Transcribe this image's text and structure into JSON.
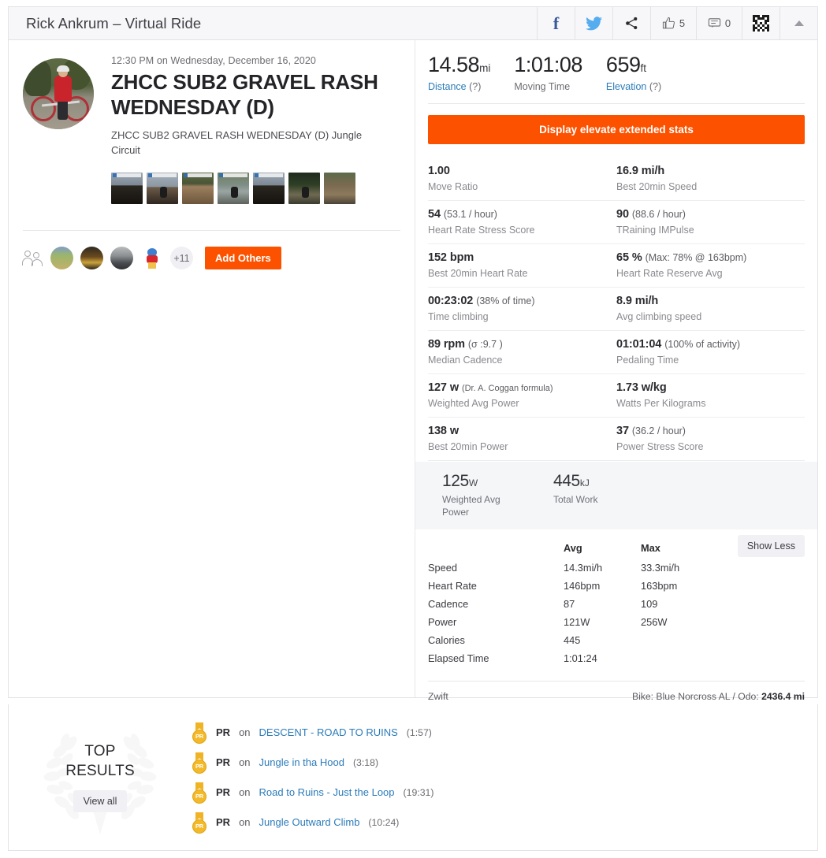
{
  "header": {
    "title": "Rick Ankrum – Virtual Ride",
    "facebook_icon": "facebook-icon",
    "twitter_icon": "twitter-icon",
    "share_icon": "share-icon",
    "kudos_count": "5",
    "comment_count": "0",
    "qr_icon": "qr-code-icon",
    "collapse_icon": "caret-up-icon"
  },
  "activity": {
    "date": "12:30 PM on Wednesday, December 16, 2020",
    "title": "ZHCC SUB2 GRAVEL RASH WEDNESDAY (D)",
    "description": "ZHCC SUB2 GRAVEL RASH WEDNESDAY (D) Jungle Circuit",
    "photo_count": 7
  },
  "others": {
    "people_icon": "people-icon",
    "avatar_count": 4,
    "more_label": "+11",
    "add_others_label": "Add Others"
  },
  "summary": [
    {
      "value": "14.58",
      "unit": "mi",
      "label": "Distance",
      "hint": "(?)",
      "link": true
    },
    {
      "value": "1:01:08",
      "unit": "",
      "label": "Moving Time",
      "hint": "",
      "link": false
    },
    {
      "value": "659",
      "unit": "ft",
      "label": "Elevation",
      "hint": "(?)",
      "link": true
    }
  ],
  "elevate_button": "Display elevate extended stats",
  "extended_stats": [
    [
      {
        "value": "1.00",
        "sub": "",
        "label": "Move Ratio"
      },
      {
        "value": "16.9 mi/h",
        "sub": "",
        "label": "Best 20min Speed"
      }
    ],
    [
      {
        "value": "54",
        "sub": "(53.1 / hour)",
        "label": "Heart Rate Stress Score"
      },
      {
        "value": "90",
        "sub": "(88.6 / hour)",
        "label": "TRaining IMPulse"
      }
    ],
    [
      {
        "value": "152 bpm",
        "sub": "",
        "label": "Best 20min Heart Rate"
      },
      {
        "value": "65 %",
        "sub": "(Max: 78% @ 163bpm)",
        "label": "Heart Rate Reserve Avg"
      }
    ],
    [
      {
        "value": "00:23:02",
        "sub": "(38% of time)",
        "label": "Time climbing"
      },
      {
        "value": "8.9 mi/h",
        "sub": "",
        "label": "Avg climbing speed"
      }
    ],
    [
      {
        "value": "89 rpm",
        "sub": "(σ :9.7 )",
        "label": "Median Cadence"
      },
      {
        "value": "01:01:04",
        "sub": "(100% of activity)",
        "label": "Pedaling Time"
      }
    ],
    [
      {
        "value": "127 w",
        "sub": "(Dr. A. Coggan formula)",
        "label": "Weighted Avg Power",
        "sub_small": true
      },
      {
        "value": "1.73 w/kg",
        "sub": "",
        "label": "Watts Per Kilograms"
      }
    ],
    [
      {
        "value": "138 w",
        "sub": "",
        "label": "Best 20min Power"
      },
      {
        "value": "37",
        "sub": "(36.2 / hour)",
        "label": "Power Stress Score"
      }
    ]
  ],
  "work_band": [
    {
      "value": "125",
      "unit": "W",
      "label": "Weighted Avg Power"
    },
    {
      "value": "445",
      "unit": "kJ",
      "label": "Total Work"
    }
  ],
  "stat_table": {
    "headers": [
      "",
      "Avg",
      "Max"
    ],
    "show_less_label": "Show Less",
    "rows": [
      {
        "name": "Speed",
        "avg": "14.3mi/h",
        "max": "33.3mi/h"
      },
      {
        "name": "Heart Rate",
        "avg": "146bpm",
        "max": "163bpm"
      },
      {
        "name": "Cadence",
        "avg": "87",
        "max": "109"
      },
      {
        "name": "Power",
        "avg": "121W",
        "max": "256W"
      },
      {
        "name": "Calories",
        "avg": "445",
        "max": ""
      },
      {
        "name": "Elapsed Time",
        "avg": "1:01:24",
        "max": ""
      }
    ]
  },
  "device": {
    "source": "Zwift",
    "bike_prefix": "Bike: Blue Norcross AL / Odo: ",
    "bike_odo": "2436.4 mi"
  },
  "top_results": {
    "title_line1": "TOP",
    "title_line2": "RESULTS",
    "view_all_label": "View all",
    "medal_text": "PR",
    "items": [
      {
        "tag": "PR",
        "on": "on",
        "segment": "DESCENT - ROAD TO RUINS",
        "time": "(1:57)"
      },
      {
        "tag": "PR",
        "on": "on",
        "segment": "Jungle in tha Hood",
        "time": "(3:18)"
      },
      {
        "tag": "PR",
        "on": "on",
        "segment": "Road to Ruins - Just the Loop",
        "time": "(19:31)"
      },
      {
        "tag": "PR",
        "on": "on",
        "segment": "Jungle Outward Climb",
        "time": "(10:24)"
      }
    ]
  },
  "colors": {
    "brand_orange": "#FC5200",
    "link_blue": "#2B7BB9",
    "facebook_blue": "#3B5998",
    "twitter_blue": "#55ACEE",
    "medal_gold": "#F3B928"
  }
}
